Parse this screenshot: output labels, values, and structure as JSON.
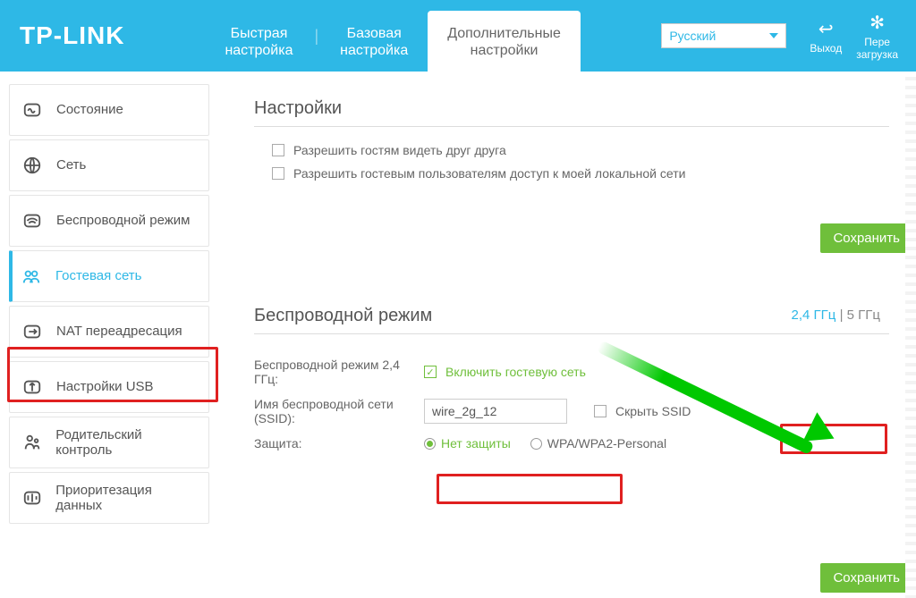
{
  "header": {
    "logo": "TP-LINK",
    "tabs": [
      {
        "line1": "Быстрая",
        "line2": "настройка"
      },
      {
        "line1": "Базовая",
        "line2": "настройка"
      },
      {
        "line1": "Дополнительные",
        "line2": "настройки"
      }
    ],
    "language": "Русский",
    "logout": "Выход",
    "reboot": {
      "line1": "Пере",
      "line2": "загрузка"
    }
  },
  "sidebar": {
    "items": [
      {
        "label": "Состояние"
      },
      {
        "label": "Сеть"
      },
      {
        "label": "Беспроводной режим"
      },
      {
        "label": "Гостевая сеть"
      },
      {
        "label": "NAT переадресация"
      },
      {
        "label": "Настройки USB"
      },
      {
        "label": "Родительский контроль"
      },
      {
        "label": "Приоритезация данных"
      }
    ]
  },
  "content": {
    "settings_title": "Настройки",
    "allow_see_each_other": "Разрешить гостям видеть друг друга",
    "allow_local_access": "Разрешить гостевым пользователям доступ к моей локальной сети",
    "save": "Сохранить",
    "wireless_title": "Беспроводной режим",
    "freq_24": "2,4 ГГц",
    "freq_5": "5 ГГц",
    "wireless_24_label": "Беспроводной режим 2,4 ГГц:",
    "enable_guest": "Включить гостевую сеть",
    "ssid_label": "Имя беспроводной сети (SSID):",
    "ssid_value": "wire_2g_12",
    "hide_ssid": "Скрыть SSID",
    "security_label": "Защита:",
    "no_security": "Нет защиты",
    "wpa": "WPA/WPA2-Personal"
  }
}
